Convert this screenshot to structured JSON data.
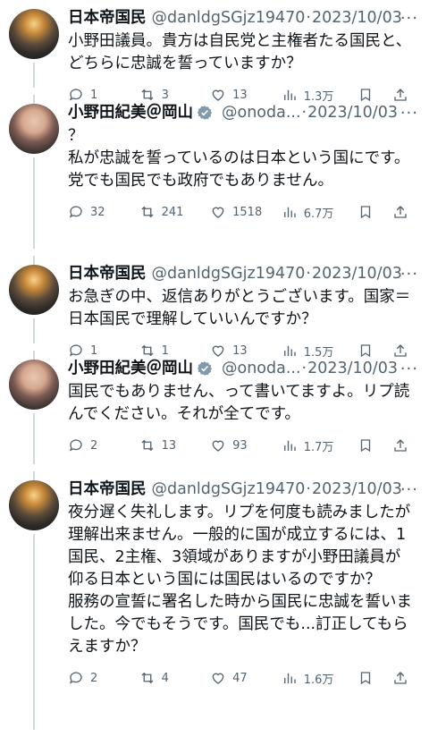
{
  "tweets": [
    {
      "name": "日本帝国民",
      "handle": "@danldgSGjz19470",
      "verified": false,
      "date": "2023/10/03",
      "text": "小野田議員。貴方は自民党と主権者たる国民と、\nどちらに忠誠を誓っていますか？",
      "replies": "1",
      "retweets": "3",
      "likes": "13",
      "views": "1.3万",
      "avatar": "sunset"
    },
    {
      "name": "小野田紀美＠岡山",
      "handle": "@onoda...",
      "verified": true,
      "date": "2023/10/03",
      "text": "？\n私が忠誠を誓っているのは日本という国にです。\n党でも国民でも政府でもありません。",
      "replies": "32",
      "retweets": "241",
      "likes": "1518",
      "views": "6.7万",
      "avatar": "person"
    },
    {
      "name": "日本帝国民",
      "handle": "@danldgSGjz19470",
      "verified": false,
      "date": "2023/10/03",
      "text": "お急ぎの中、返信ありがとうございます。国家＝\n日本国民で理解していいんですか？",
      "replies": "1",
      "retweets": "1",
      "likes": "13",
      "views": "1.5万",
      "avatar": "sunset"
    },
    {
      "name": "小野田紀美＠岡山",
      "handle": "@onoda...",
      "verified": true,
      "date": "2023/10/03",
      "text": "国民でもありません、って書いてますよ。リプ読\nんでください。それが全てです。",
      "replies": "2",
      "retweets": "13",
      "likes": "93",
      "views": "1.7万",
      "avatar": "person"
    },
    {
      "name": "日本帝国民",
      "handle": "@danldgSGjz19470",
      "verified": false,
      "date": "2023/10/03",
      "text": "夜分遅く失礼します。リプを何度も読みましたが\n理解出来ません。一般的に国が成立するには、1\n国民、2主権、3領域がありますが小野田議員が\n仰る日本という国には国民はいるのですか？\n服務の宣誓に署名した時から国民に忠誠を誓いま\nした。今でもそうです。国民でも...訂正してもら\nえますか？",
      "replies": "2",
      "retweets": "4",
      "likes": "47",
      "views": "1.6万",
      "avatar": "sunset"
    }
  ],
  "colors": {
    "text": "#0f1419",
    "muted": "#536471",
    "verified": "#829aab",
    "thread": "#cfd9de"
  },
  "icons": [
    "reply-icon",
    "retweet-icon",
    "like-icon",
    "views-icon",
    "bookmark-icon",
    "share-icon",
    "more-icon",
    "verified-badge-icon"
  ]
}
